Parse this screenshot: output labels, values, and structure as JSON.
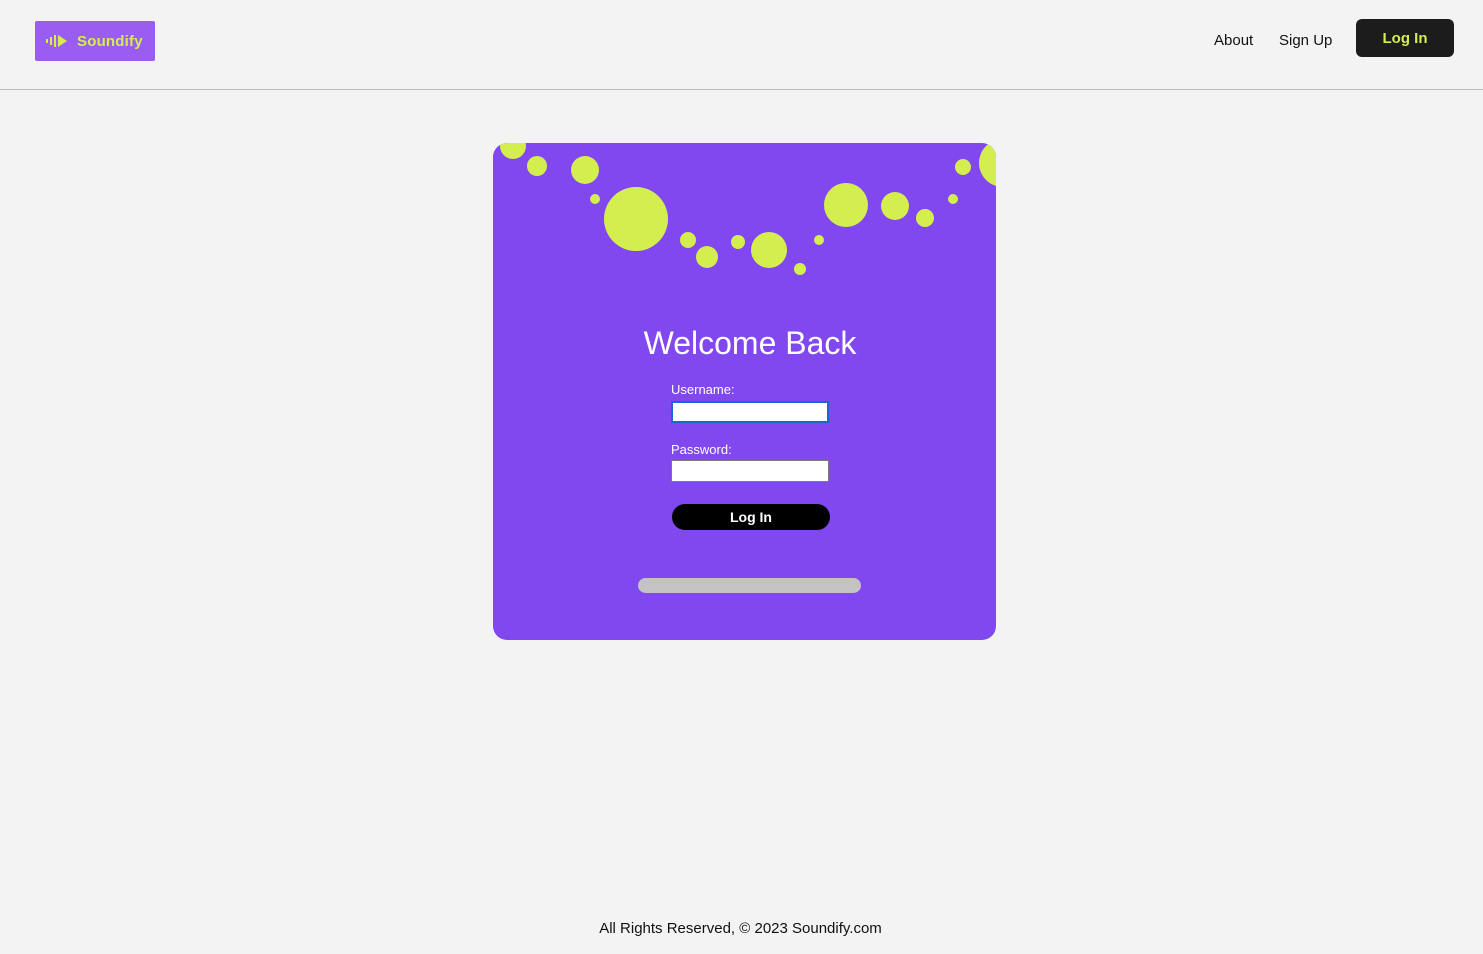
{
  "brand": {
    "name": "Soundify",
    "accent": "#d4ee4f",
    "logo_bg": "#9b5cf2"
  },
  "nav": {
    "about": "About",
    "sign_up": "Sign Up",
    "log_in": "Log In"
  },
  "login_card": {
    "title": "Welcome Back",
    "username_label": "Username:",
    "username_value": "",
    "password_label": "Password:",
    "password_value": "",
    "submit_label": "Log In",
    "card_color": "#8148f0",
    "bubble_color": "#d4ee4f"
  },
  "footer": {
    "text": "All Rights Reserved, © 2023 Soundify.com"
  }
}
